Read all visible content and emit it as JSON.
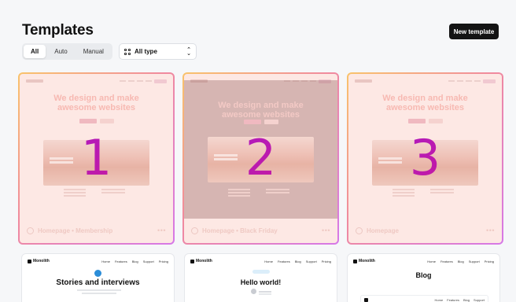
{
  "header": {
    "title": "Templates",
    "new_button": "New template"
  },
  "filters": {
    "segments": [
      {
        "label": "All",
        "active": true
      },
      {
        "label": "Auto",
        "active": false
      },
      {
        "label": "Manual",
        "active": false
      }
    ],
    "type_select": {
      "value": "All type"
    }
  },
  "cards": [
    {
      "number": "1",
      "name": "Homepage • Membership",
      "hero": [
        "We design and make",
        "awesome websites"
      ]
    },
    {
      "number": "2",
      "name": "Homepage • Black Friday",
      "hero": [
        "We design and make",
        "awesome websites"
      ]
    },
    {
      "number": "3",
      "name": "Homepage",
      "hero": [
        "We design and make",
        "awesome websites"
      ]
    }
  ],
  "bottom_cards": [
    {
      "brand": "Monolith",
      "nav": [
        "Home",
        "Features",
        "Blog",
        "Support",
        "Pricing"
      ],
      "title": "Stories and interviews"
    },
    {
      "brand": "Monolith",
      "nav": [
        "Home",
        "Features",
        "Blog",
        "Support",
        "Pricing"
      ],
      "title": "Hello world!"
    },
    {
      "brand": "Monolith",
      "nav": [
        "Home",
        "Features",
        "Blog",
        "Support",
        "Pricing"
      ],
      "title": "Blog"
    }
  ],
  "colors": {
    "accent_gradient": [
      "#f9c36b",
      "#f08a9e",
      "#d678e8"
    ],
    "number_gradient": [
      "#a31ad1",
      "#d21a8e"
    ],
    "primary_button": "#141414"
  },
  "icons": {
    "type_select": "grid-icon",
    "select_arrow": "updown-icon",
    "card_type": "circle-icon",
    "card_menu": "more-icon"
  }
}
